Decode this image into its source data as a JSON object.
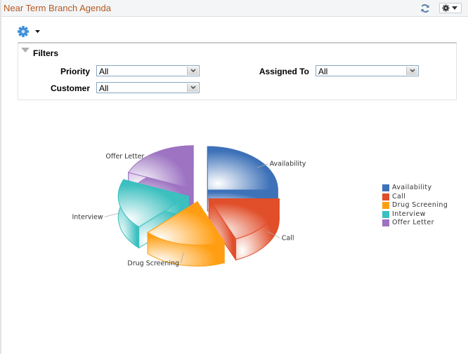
{
  "header": {
    "title": "Near Term Branch Agenda",
    "refresh_icon": "refresh-icon",
    "actions_icon": "gear-icon"
  },
  "toolbar": {
    "menu_icon": "gear-icon"
  },
  "filters": {
    "label": "Filters",
    "fields": [
      {
        "label": "Priority",
        "value": "All"
      },
      {
        "label": "Customer",
        "value": "All"
      },
      {
        "label": "Assigned To",
        "value": "All"
      }
    ]
  },
  "chart_data": {
    "type": "pie",
    "title": "",
    "categories": [
      "Availability",
      "Call",
      "Drug Screening",
      "Interview",
      "Offer Letter"
    ],
    "values": [
      4,
      3,
      3,
      3,
      3
    ],
    "colors": [
      "#3d71b8",
      "#e04e2a",
      "#ff9e12",
      "#3bbfbf",
      "#9d73c2"
    ],
    "legend": "right",
    "style": "3d-exploded"
  }
}
